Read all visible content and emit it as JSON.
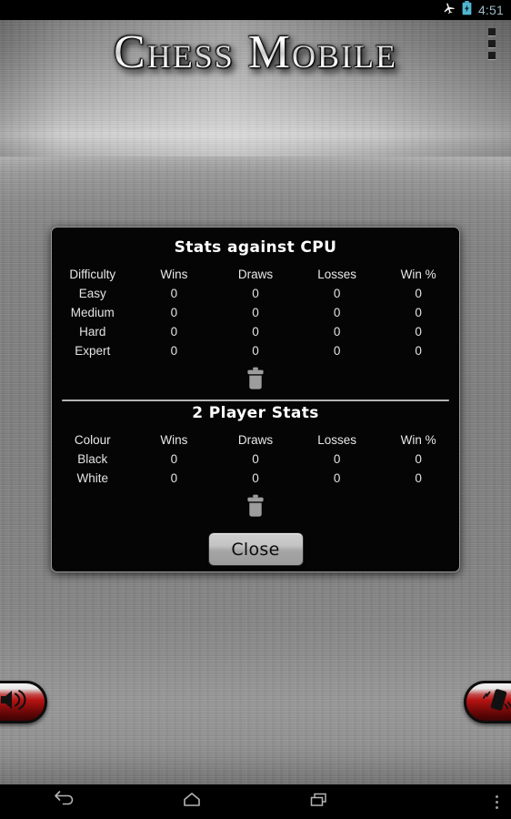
{
  "status_bar": {
    "airplane_icon": "airplane-mode-icon",
    "battery_icon": "battery-charging-icon",
    "time": "4:51"
  },
  "app": {
    "title": "Chess Mobile",
    "overflow_icon": "overflow-menu-icon"
  },
  "dialog": {
    "cpu_section": {
      "title": "Stats against CPU",
      "columns": [
        "Difficulty",
        "Wins",
        "Draws",
        "Losses",
        "Win %"
      ],
      "rows": [
        [
          "Easy",
          "0",
          "0",
          "0",
          "0"
        ],
        [
          "Medium",
          "0",
          "0",
          "0",
          "0"
        ],
        [
          "Hard",
          "0",
          "0",
          "0",
          "0"
        ],
        [
          "Expert",
          "0",
          "0",
          "0",
          "0"
        ]
      ],
      "clear_icon": "trash-icon"
    },
    "two_player_section": {
      "title": "2 Player Stats",
      "columns": [
        "Colour",
        "Wins",
        "Draws",
        "Losses",
        "Win %"
      ],
      "rows": [
        [
          "Black",
          "0",
          "0",
          "0",
          "0"
        ],
        [
          "White",
          "0",
          "0",
          "0",
          "0"
        ]
      ],
      "clear_icon": "trash-icon"
    },
    "close_label": "Close"
  },
  "controls": {
    "sound_icon": "speaker-volume-icon",
    "vibrate_icon": "vibrate-icon"
  },
  "nav_bar": {
    "back_icon": "back-arrow-icon",
    "home_icon": "home-icon",
    "recents_icon": "recent-apps-icon",
    "overflow_icon": "overflow-menu-icon"
  },
  "colors": {
    "dialog_background": "#050505",
    "accent_red": "#b81414",
    "metal_grey": "#8a8a8a",
    "status_time": "#9fb8c4"
  }
}
